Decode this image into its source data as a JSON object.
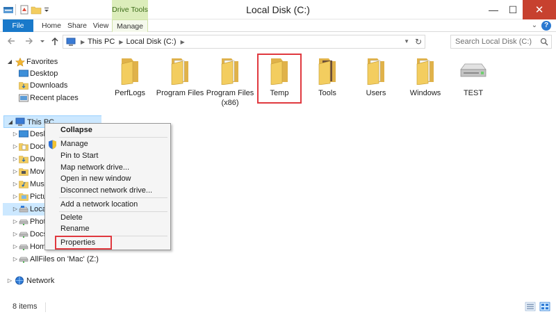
{
  "window": {
    "title": "Local Disk (C:)",
    "contextual_tab_group": "Drive Tools",
    "minimize": "—",
    "maximize": "☐",
    "close": "✕"
  },
  "ribbon": {
    "tabs": [
      "File",
      "Home",
      "Share",
      "View",
      "Manage"
    ],
    "expand_glyph": "⌄",
    "help_glyph": "?"
  },
  "address_bar": {
    "breadcrumbs": [
      "This PC",
      "Local Disk (C:)"
    ],
    "search_placeholder": "Search Local Disk (C:)"
  },
  "nav_pane": {
    "favorites_label": "Favorites",
    "favorites": [
      "Desktop",
      "Downloads",
      "Recent places"
    ],
    "this_pc_label": "This PC",
    "this_pc_children": [
      "Desk",
      "Docu",
      "Dow",
      "Mov",
      "Musi",
      "Pictu",
      "Local",
      "Phot",
      "Docs",
      "Hom",
      "AllFiles on 'Mac' (Z:)"
    ],
    "network_label": "Network"
  },
  "content": {
    "items": [
      {
        "name": "PerfLogs",
        "type": "folder"
      },
      {
        "name": "Program Files",
        "type": "folder"
      },
      {
        "name": "Program Files (x86)",
        "type": "folder"
      },
      {
        "name": "Temp",
        "type": "folder",
        "highlighted": true
      },
      {
        "name": "Tools",
        "type": "folder"
      },
      {
        "name": "Users",
        "type": "folder"
      },
      {
        "name": "Windows",
        "type": "folder"
      },
      {
        "name": "TEST",
        "type": "drive"
      }
    ]
  },
  "context_menu": {
    "items": [
      "Collapse",
      "Manage",
      "Pin to Start",
      "Map network drive...",
      "Open in new window",
      "Disconnect network drive...",
      "Add a network location",
      "Delete",
      "Rename",
      "Properties"
    ],
    "highlighted_item": "Properties"
  },
  "status_bar": {
    "item_count": "8 items"
  },
  "colors": {
    "file_tab": "#1979ca",
    "drive_tools": "#dcedbb",
    "close_button": "#c7412f",
    "selection": "#cce8ff",
    "highlight_box": "#e0383e",
    "folder_yellow": "#f3cd5f"
  }
}
